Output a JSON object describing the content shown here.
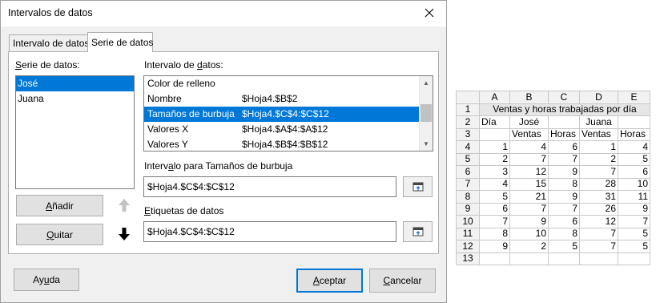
{
  "dialog": {
    "title": "Intervalos de datos",
    "tabs": [
      {
        "label": "Intervalo de datos",
        "active": false
      },
      {
        "label": "Serie de datos",
        "active": true
      }
    ],
    "series_label": "Serie de datos:",
    "series": [
      "José",
      "Juana"
    ],
    "selected_series": "José",
    "ranges_label": "Intervalo de datos:",
    "ranges": [
      {
        "role": "Color de relleno",
        "range": ""
      },
      {
        "role": "Nombre",
        "range": "$Hoja4.$B$2"
      },
      {
        "role": "Tamaños de burbuja",
        "range": "$Hoja4.$C$4:$C$12"
      },
      {
        "role": "Valores X",
        "range": "$Hoja4.$A$4:$A$12"
      },
      {
        "role": "Valores Y",
        "range": "$Hoja4.$B$4:$B$12"
      }
    ],
    "selected_range_index": 2,
    "range_for_label": "Intervalo para Tamaños de burbuja",
    "range_for_value": "$Hoja4.$C$4:$C$12",
    "data_labels_label": "Etiquetas de datos",
    "data_labels_value": "$Hoja4.$C$4:$C$12",
    "buttons": {
      "add": "Añadir",
      "remove": "Quitar",
      "help": "Ayuda",
      "ok": "Aceptar",
      "cancel": "Cancelar"
    }
  },
  "spreadsheet": {
    "columns": [
      "A",
      "B",
      "C",
      "D",
      "E"
    ],
    "rows": [
      "1",
      "2",
      "3",
      "4",
      "5",
      "6",
      "7",
      "8",
      "9",
      "10",
      "11",
      "12",
      "13"
    ],
    "title": "Ventas y horas trabajadas  por día",
    "row2": {
      "a": "Día",
      "b": "José",
      "d": "Juana"
    },
    "row3": {
      "b": "Ventas",
      "c": "Horas",
      "d": "Ventas",
      "e": "Horas"
    },
    "data": [
      [
        "1",
        "4",
        "6",
        "1",
        "4"
      ],
      [
        "2",
        "7",
        "7",
        "2",
        "5"
      ],
      [
        "3",
        "12",
        "9",
        "7",
        "6"
      ],
      [
        "4",
        "15",
        "8",
        "28",
        "10"
      ],
      [
        "5",
        "21",
        "9",
        "31",
        "11"
      ],
      [
        "6",
        "7",
        "7",
        "26",
        "9"
      ],
      [
        "7",
        "9",
        "6",
        "12",
        "7"
      ],
      [
        "8",
        "10",
        "8",
        "7",
        "5"
      ],
      [
        "9",
        "2",
        "5",
        "7",
        "5"
      ]
    ]
  }
}
